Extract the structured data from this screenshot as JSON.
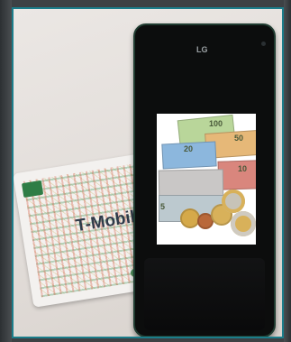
{
  "image": {
    "card": {
      "text": "T-Mobili"
    },
    "phone": {
      "brand": "LG"
    },
    "screen": {
      "denominations": [
        "100",
        "50",
        "20",
        "10",
        "5"
      ]
    }
  }
}
